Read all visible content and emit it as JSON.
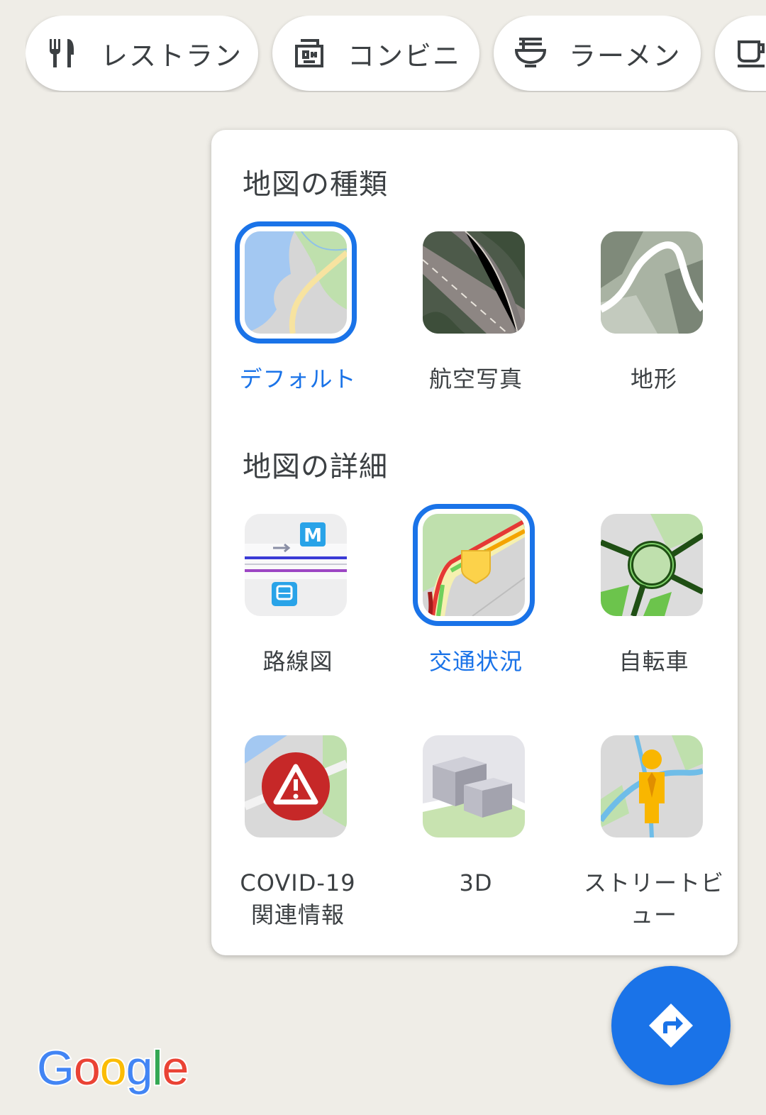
{
  "chips": [
    {
      "label": "レストラン",
      "icon": "restaurant-icon"
    },
    {
      "label": "コンビニ",
      "icon": "convenience-store-icon"
    },
    {
      "label": "ラーメン",
      "icon": "ramen-icon"
    },
    {
      "label": "",
      "icon": "cafe-icon"
    }
  ],
  "map_types": {
    "title": "地図の種類",
    "options": [
      {
        "label": "デフォルト",
        "selected": true
      },
      {
        "label": "航空写真",
        "selected": false
      },
      {
        "label": "地形",
        "selected": false
      }
    ]
  },
  "map_details": {
    "title": "地図の詳細",
    "options": [
      {
        "label": "路線図",
        "selected": false
      },
      {
        "label": "交通状況",
        "selected": true
      },
      {
        "label": "自転車",
        "selected": false
      },
      {
        "label": "COVID-19 関連情報",
        "selected": false
      },
      {
        "label": "3D",
        "selected": false
      },
      {
        "label": "ストリートビュー",
        "selected": false
      }
    ]
  },
  "logo": {
    "letters": [
      "G",
      "o",
      "o",
      "g",
      "l",
      "e"
    ]
  },
  "colors": {
    "accent": "#1a73e8",
    "map_bg": "#efede7"
  },
  "fab": {
    "icon": "directions-icon"
  }
}
